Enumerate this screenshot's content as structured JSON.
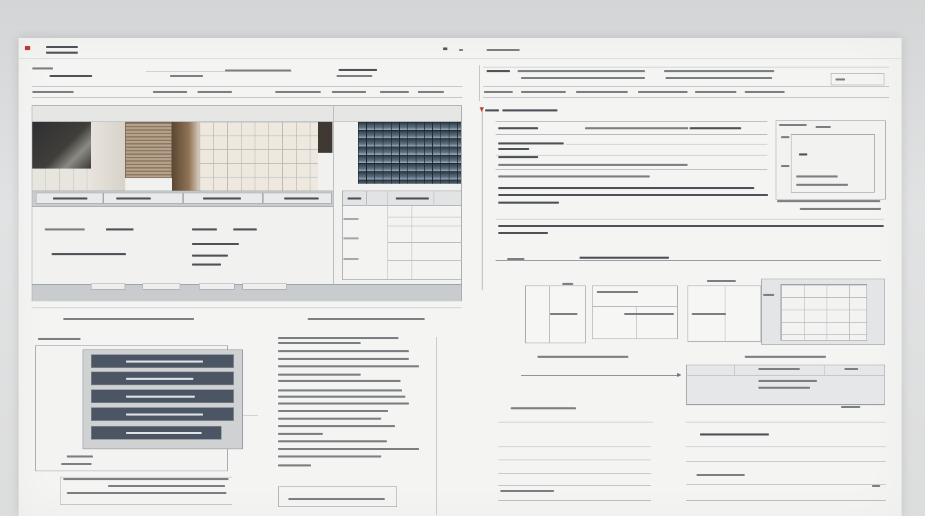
{
  "colors": {
    "background": "#d9dadb",
    "sheet": "#f4f4f3",
    "accent": "#c0392b",
    "line": "#b9bbbd",
    "panel": "#c9ccce",
    "menu_item": "#4b5563"
  },
  "icons": [
    "logo-mark-icon",
    "arrow-marker-icon",
    "arrow-right-icon"
  ]
}
